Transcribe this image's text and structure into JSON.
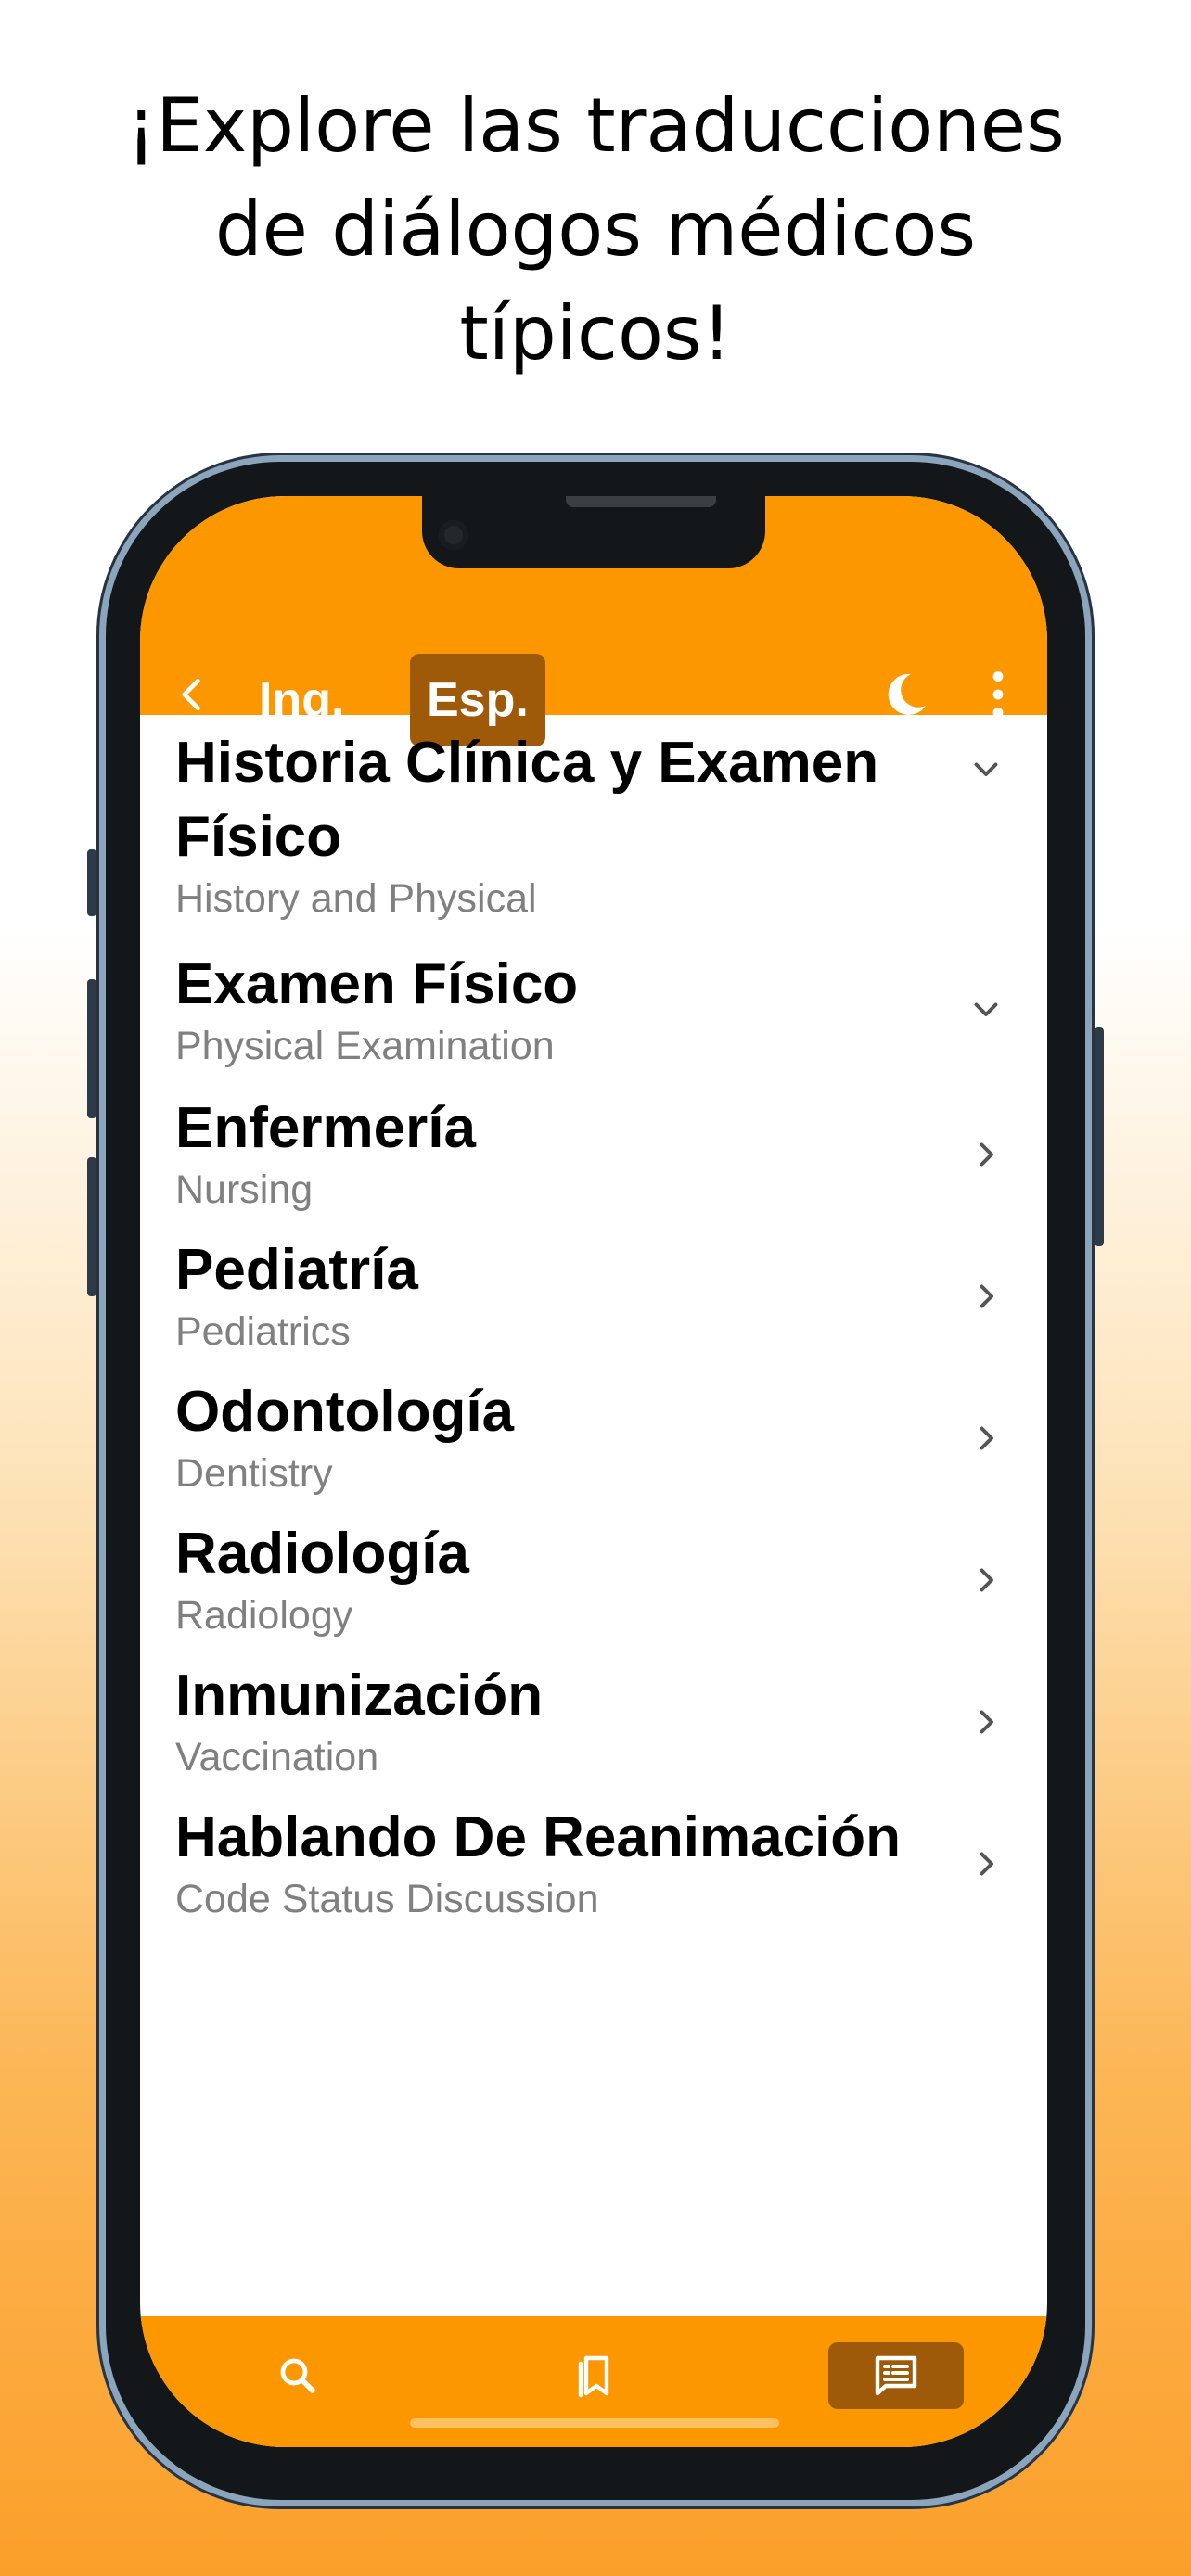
{
  "headline": {
    "line1": "¡Explore las traducciones",
    "line2": "de diálogos médicos",
    "line3": "típicos!"
  },
  "colors": {
    "accent": "#fd9700",
    "accent_dark": "#9e5a08",
    "subtitle_gray": "#808080"
  },
  "topbar": {
    "back_icon": "chevron-left-icon",
    "tab_english": "Ing.",
    "tab_spanish": "Esp.",
    "active_tab": "Esp.",
    "dark_mode_icon": "moon-icon",
    "menu_icon": "more-vertical-icon"
  },
  "dialogs": [
    {
      "title": "Historia Clínica y Examen Físico",
      "subtitle": "History and Physical",
      "icon": "chevron-down-icon"
    },
    {
      "title": "Examen Físico",
      "subtitle": "Physical Examination",
      "icon": "chevron-down-icon"
    },
    {
      "title": "Enfermería",
      "subtitle": "Nursing",
      "icon": "chevron-right-icon"
    },
    {
      "title": "Pediatría",
      "subtitle": "Pediatrics",
      "icon": "chevron-right-icon"
    },
    {
      "title": "Odontología",
      "subtitle": "Dentistry",
      "icon": "chevron-right-icon"
    },
    {
      "title": "Radiología",
      "subtitle": "Radiology",
      "icon": "chevron-right-icon"
    },
    {
      "title": "Inmunización",
      "subtitle": "Vaccination",
      "icon": "chevron-right-icon"
    },
    {
      "title": "Hablando De Reanimación",
      "subtitle": "Code Status Discussion",
      "icon": "chevron-right-icon"
    }
  ],
  "bottom_nav": {
    "items": [
      {
        "icon": "search-icon"
      },
      {
        "icon": "bookmarks-icon"
      },
      {
        "icon": "dialogs-icon",
        "active": true
      }
    ]
  }
}
